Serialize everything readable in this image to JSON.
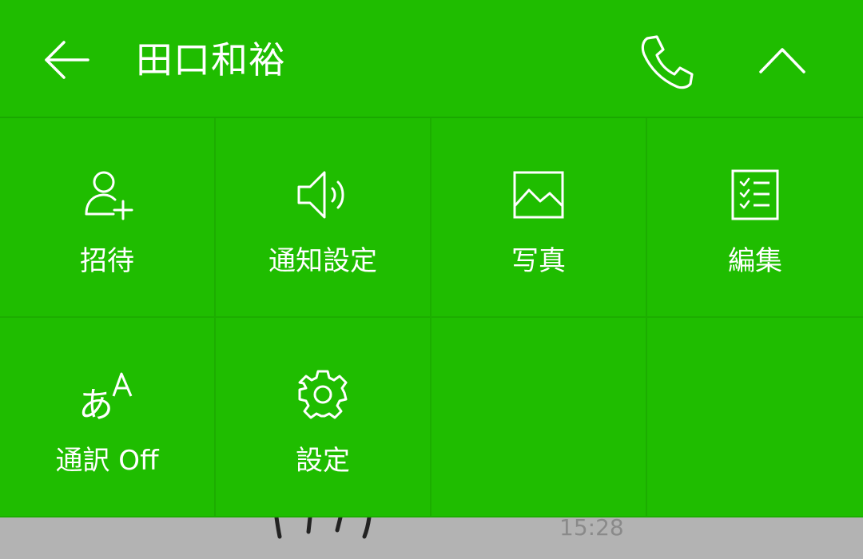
{
  "colors": {
    "header_bg": "#1fbd00",
    "menu_bg": "#1fbd00",
    "divider": "#1cad00",
    "text": "#ffffff",
    "backdrop": "#b3b3b3"
  },
  "header": {
    "back_icon": "arrow-left-icon",
    "title": "田口和裕",
    "call_icon": "phone-icon",
    "collapse_icon": "chevron-up-icon"
  },
  "menu": {
    "items": [
      {
        "label": "招待",
        "icon": "add-friend-icon"
      },
      {
        "label": "通知設定",
        "icon": "speaker-icon"
      },
      {
        "label": "写真",
        "icon": "photo-icon"
      },
      {
        "label": "編集",
        "icon": "checklist-icon"
      },
      {
        "label": "通訳 Off",
        "icon": "translate-icon"
      },
      {
        "label": "設定",
        "icon": "gear-icon"
      }
    ]
  },
  "background_chat": {
    "timestamp": "15:28"
  }
}
